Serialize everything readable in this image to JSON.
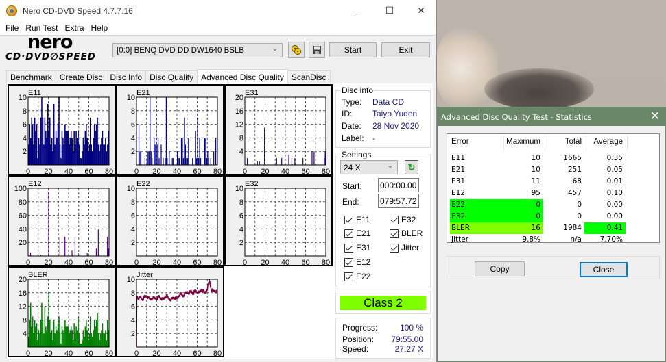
{
  "window": {
    "title": "Nero CD-DVD Speed 4.7.7.16",
    "controls": {
      "minimize": "—",
      "maximize": "☐",
      "close": "✕"
    }
  },
  "menu": [
    "File",
    "Run Test",
    "Extra",
    "Help"
  ],
  "toolbar": {
    "logo_top": "nero",
    "logo_bottom": "CD·DVD∅SPEED",
    "drive": "[0:0]   BENQ DVD DD DW1640 BSLB",
    "start_label": "Start",
    "exit_label": "Exit",
    "icons": [
      "drive-eject-icon",
      "save-icon"
    ]
  },
  "tabs": [
    {
      "label": "Benchmark",
      "active": false
    },
    {
      "label": "Create Disc",
      "active": false
    },
    {
      "label": "Disc Info",
      "active": false
    },
    {
      "label": "Disc Quality",
      "active": false
    },
    {
      "label": "Advanced Disc Quality",
      "active": true
    },
    {
      "label": "ScanDisc",
      "active": false
    }
  ],
  "disc_info": {
    "title": "Disc info",
    "rows": [
      {
        "label": "Type:",
        "value": "Data CD"
      },
      {
        "label": "ID:",
        "value": "Taiyo Yuden"
      },
      {
        "label": "Date:",
        "value": "28 Nov 2020"
      },
      {
        "label": "Label:",
        "value": "-"
      }
    ]
  },
  "settings": {
    "title": "Settings",
    "speed": "24 X",
    "start_label": "Start:",
    "start_value": "000:00.00",
    "end_label": "End:",
    "end_value": "079:57.72",
    "checkboxes": [
      {
        "label": "E11",
        "checked": true
      },
      {
        "label": "E21",
        "checked": true
      },
      {
        "label": "E31",
        "checked": true
      },
      {
        "label": "E12",
        "checked": true
      },
      {
        "label": "E22",
        "checked": true
      },
      {
        "label": "E32",
        "checked": true
      },
      {
        "label": "BLER",
        "checked": true
      },
      {
        "label": "Jitter",
        "checked": true
      }
    ]
  },
  "class_badge": {
    "label": "Class 2",
    "color": "#80ff00"
  },
  "status": {
    "progress_label": "Progress:",
    "progress_value": "100 %",
    "position_label": "Position:",
    "position_value": "79:55.00",
    "speed_label": "Speed:",
    "speed_value": "27.27 X"
  },
  "stats_dialog": {
    "title": "Advanced Disc Quality Test - Statistics",
    "headers": [
      "Error",
      "Maximum",
      "Total",
      "Average"
    ],
    "rows": [
      {
        "error": "E11",
        "maximum": "10",
        "total": "1665",
        "average": "0.35",
        "hl_left": "",
        "hl_avg": ""
      },
      {
        "error": "E21",
        "maximum": "10",
        "total": "251",
        "average": "0.05",
        "hl_left": "",
        "hl_avg": ""
      },
      {
        "error": "E31",
        "maximum": "11",
        "total": "68",
        "average": "0.01",
        "hl_left": "",
        "hl_avg": ""
      },
      {
        "error": "E12",
        "maximum": "95",
        "total": "457",
        "average": "0.10",
        "hl_left": "",
        "hl_avg": ""
      },
      {
        "error": "E22",
        "maximum": "0",
        "total": "0",
        "average": "0.00",
        "hl_left": "#00ff00",
        "hl_avg": ""
      },
      {
        "error": "E32",
        "maximum": "0",
        "total": "0",
        "average": "0.00",
        "hl_left": "#00ff00",
        "hl_avg": ""
      },
      {
        "error": "BLER",
        "maximum": "16",
        "total": "1984",
        "average": "0.41",
        "hl_left": "#80ff00",
        "hl_avg": "#00ff00"
      },
      {
        "error": "Jitter",
        "maximum": "9.8%",
        "total": "n/a",
        "average": "7.70%",
        "hl_left": "",
        "hl_avg": ""
      }
    ],
    "copy_label": "Copy",
    "close_label": "Close"
  },
  "chart_data": [
    {
      "type": "bar",
      "title": "E11",
      "color": "#000080",
      "xlim": [
        0,
        80
      ],
      "ylim": [
        0,
        10
      ],
      "xticks": [
        "0",
        "20",
        "40",
        "60",
        "80"
      ],
      "yticks": [
        "2",
        "4",
        "6",
        "8",
        "10"
      ],
      "x": [
        0,
        1,
        2,
        3,
        4,
        5,
        6,
        7,
        8,
        9,
        10,
        11,
        12,
        13,
        14,
        15,
        16,
        17,
        18,
        19,
        20,
        21,
        22,
        23,
        24,
        25,
        26,
        27,
        28,
        29,
        30,
        31,
        32,
        33,
        34,
        35,
        36,
        37,
        38,
        39,
        40,
        41,
        42,
        43,
        44,
        45,
        46,
        47,
        48,
        49,
        50,
        51,
        52,
        53,
        54,
        55,
        56,
        57,
        58,
        59,
        60,
        61,
        62,
        63,
        64,
        65,
        66,
        67,
        68,
        69,
        70,
        71,
        72,
        73,
        74,
        75,
        76,
        77,
        78,
        79
      ],
      "values": [
        3,
        6,
        4,
        7,
        6,
        3,
        7,
        5,
        6,
        1,
        4,
        3,
        7,
        10,
        7,
        3,
        7,
        5,
        4,
        9,
        5,
        7,
        3,
        4,
        2,
        9,
        3,
        5,
        4,
        6,
        10,
        3,
        1,
        5,
        4,
        3,
        6,
        5,
        5,
        5,
        3,
        4,
        5,
        4,
        2,
        5,
        3,
        5,
        4,
        5,
        3,
        1,
        1,
        2,
        4,
        3,
        5,
        6,
        4,
        2,
        3,
        7,
        3,
        2,
        4,
        6,
        5,
        6,
        7,
        3,
        2,
        3,
        4,
        5,
        3,
        3,
        4,
        2,
        3,
        5
      ]
    },
    {
      "type": "bar",
      "title": "E21",
      "color": "#000080",
      "xlim": [
        0,
        80
      ],
      "ylim": [
        0,
        10
      ],
      "xticks": [
        "0",
        "20",
        "40",
        "60",
        "80"
      ],
      "yticks": [
        "2",
        "4",
        "6",
        "8",
        "10"
      ],
      "x": [
        2,
        3,
        4,
        8,
        10,
        11,
        12,
        13,
        14,
        15,
        17,
        18,
        19,
        20,
        21,
        22,
        24,
        26,
        28,
        29,
        30,
        32,
        35,
        36,
        40,
        41,
        42,
        44,
        45,
        46,
        47,
        48,
        49,
        50,
        51,
        55,
        58,
        59,
        60,
        61,
        62,
        63,
        67,
        68,
        69,
        70,
        71,
        73,
        76,
        78
      ],
      "values": [
        6,
        2,
        2,
        1,
        1,
        2,
        2,
        10,
        2,
        1,
        4,
        3,
        7,
        3,
        4,
        1,
        3,
        1,
        1,
        10,
        1,
        2,
        1,
        1,
        2,
        1,
        1,
        4,
        4,
        1,
        7,
        3,
        1,
        1,
        4,
        1,
        5,
        1,
        7,
        1,
        4,
        1,
        4,
        4,
        1,
        2,
        1,
        1,
        2,
        4
      ]
    },
    {
      "type": "bar",
      "title": "E31",
      "color": "#2a0080",
      "xlim": [
        0,
        80
      ],
      "ylim": [
        0,
        20
      ],
      "xticks": [
        "0",
        "20",
        "40",
        "60",
        "80"
      ],
      "yticks": [
        "4",
        "8",
        "12",
        "16",
        "20"
      ],
      "x": [
        2,
        12,
        14,
        19,
        31,
        36,
        43,
        46,
        49,
        57,
        66,
        68,
        78,
        79
      ],
      "values": [
        2,
        1,
        1,
        11,
        2,
        2,
        3,
        2,
        2,
        2,
        4,
        4,
        2,
        4
      ]
    },
    {
      "type": "bar",
      "title": "E12",
      "color": "#5a0090",
      "xlim": [
        0,
        80
      ],
      "ylim": [
        0,
        100
      ],
      "xticks": [
        "0",
        "20",
        "40",
        "60",
        "80"
      ],
      "yticks": [
        "20",
        "40",
        "60",
        "80",
        "100"
      ],
      "x": [
        2,
        12,
        14,
        20,
        31,
        36,
        43,
        46,
        49,
        58,
        67,
        69,
        78,
        79
      ],
      "values": [
        5,
        2,
        2,
        95,
        28,
        28,
        8,
        28,
        5,
        4,
        11,
        39,
        28,
        11
      ]
    },
    {
      "type": "bar",
      "title": "E22",
      "color": "#000080",
      "xlim": [
        0,
        80
      ],
      "ylim": [
        0,
        10
      ],
      "xticks": [
        "0",
        "20",
        "40",
        "60",
        "80"
      ],
      "yticks": [
        "2",
        "4",
        "6",
        "8",
        "10"
      ],
      "x": [],
      "values": []
    },
    {
      "type": "bar",
      "title": "E32",
      "color": "#000080",
      "xlim": [
        0,
        80
      ],
      "ylim": [
        0,
        10
      ],
      "xticks": [
        "0",
        "20",
        "40",
        "60",
        "80"
      ],
      "yticks": [
        "2",
        "4",
        "6",
        "8",
        "10"
      ],
      "x": [],
      "values": []
    },
    {
      "type": "bar",
      "title": "BLER",
      "color": "#008000",
      "xlim": [
        0,
        80
      ],
      "ylim": [
        0,
        20
      ],
      "xticks": [
        "0",
        "20",
        "40",
        "60",
        "80"
      ],
      "yticks": [
        "4",
        "8",
        "12",
        "16",
        "20"
      ],
      "x": [
        0,
        1,
        2,
        3,
        4,
        5,
        6,
        7,
        8,
        9,
        10,
        11,
        12,
        13,
        14,
        15,
        16,
        17,
        18,
        19,
        20,
        21,
        22,
        23,
        24,
        25,
        26,
        27,
        28,
        29,
        30,
        31,
        32,
        33,
        34,
        35,
        36,
        37,
        38,
        39,
        40,
        41,
        42,
        43,
        44,
        45,
        46,
        47,
        48,
        49,
        50,
        51,
        52,
        53,
        54,
        55,
        56,
        57,
        58,
        59,
        60,
        61,
        62,
        63,
        64,
        65,
        66,
        67,
        68,
        69,
        70,
        71,
        72,
        73,
        74,
        75,
        76,
        77,
        78,
        79
      ],
      "values": [
        3,
        8,
        13,
        6,
        9,
        4,
        8,
        6,
        7,
        2,
        5,
        4,
        8,
        13,
        8,
        4,
        12,
        6,
        5,
        9,
        16,
        8,
        4,
        5,
        2,
        8,
        4,
        6,
        5,
        7,
        9,
        4,
        1,
        6,
        5,
        4,
        8,
        6,
        6,
        6,
        4,
        5,
        6,
        5,
        2,
        7,
        4,
        6,
        5,
        9,
        4,
        1,
        1,
        2,
        5,
        3,
        6,
        8,
        5,
        2,
        4,
        9,
        4,
        3,
        5,
        8,
        6,
        8,
        10,
        4,
        2,
        4,
        5,
        7,
        4,
        4,
        5,
        2,
        8,
        5
      ]
    },
    {
      "type": "line",
      "title": "Jitter",
      "color": "#800040",
      "xlim": [
        0,
        80
      ],
      "ylim": [
        0,
        10
      ],
      "xticks": [
        "0",
        "20",
        "40",
        "60",
        "80"
      ],
      "yticks": [
        "2",
        "4",
        "6",
        "8",
        "10"
      ],
      "x": [
        0,
        0.3,
        2,
        4,
        6,
        8,
        10,
        12,
        14,
        16,
        18,
        20,
        22,
        24,
        26,
        28,
        30,
        32,
        34,
        36,
        38,
        40,
        42,
        44,
        46,
        48,
        50,
        52,
        54,
        56,
        58,
        60,
        62,
        64,
        66,
        68,
        70,
        72,
        74,
        76,
        78,
        80
      ],
      "values": [
        0.1,
        7.4,
        7.2,
        7.3,
        7.0,
        7.4,
        7.5,
        7.2,
        7.0,
        7.3,
        7.2,
        7.1,
        7.5,
        7.2,
        7.0,
        7.3,
        7.6,
        7.1,
        7.0,
        7.2,
        7.3,
        7.1,
        7.6,
        7.8,
        7.5,
        7.9,
        8.1,
        8.0,
        8.2,
        7.9,
        8.3,
        8.1,
        8.0,
        8.4,
        8.2,
        8.0,
        8.6,
        9.8,
        8.5,
        8.2,
        8.3,
        8.1
      ]
    }
  ]
}
